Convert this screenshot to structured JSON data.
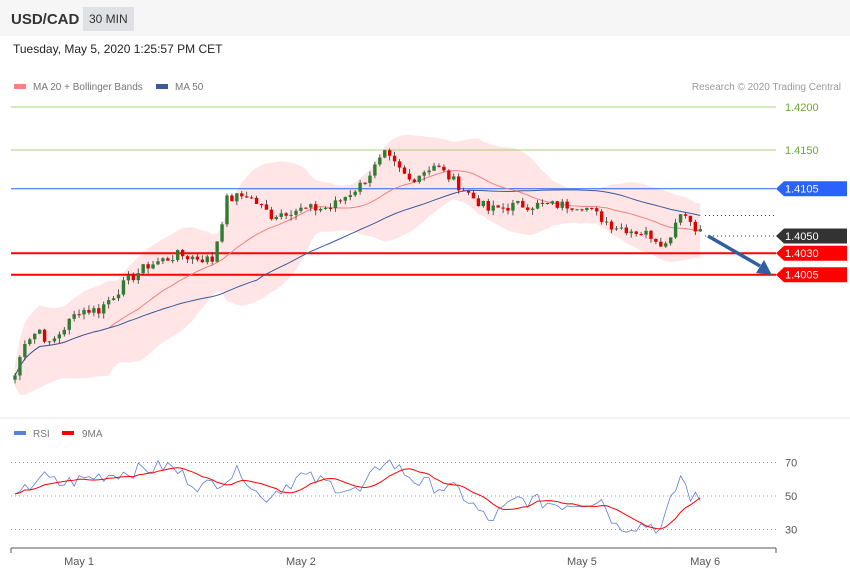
{
  "header": {
    "symbol": "USD/CAD",
    "timeframe": "30 MIN"
  },
  "timestamp": "Tuesday, May 5, 2020 1:25:57 PM CET",
  "legend": {
    "ma20": "MA 20 + Bollinger Bands",
    "ma50": "MA 50",
    "copyright": "Research © 2020 Trading Central"
  },
  "rsi_legend": {
    "rsi": "RSI",
    "ma9": "9MA"
  },
  "colors": {
    "up": "#2e7d32",
    "down": "#e00000",
    "ma20": "#f08080",
    "ma50": "#3a5a9a",
    "band": "#ffdede",
    "resistance": "#2962ff",
    "support": "#ff0000",
    "rsi": "#5b7fdc",
    "rsi_ma": "#ff0000",
    "target_grid": "#8bc34a"
  },
  "chart_data": {
    "type": "candlestick",
    "price_labels": [
      "1.4200",
      "1.4150"
    ],
    "levels": [
      {
        "value": "1.4105",
        "kind": "resistance"
      },
      {
        "value": "1.4050",
        "kind": "last"
      },
      {
        "value": "1.4030",
        "kind": "support"
      },
      {
        "value": "1.4005",
        "kind": "support"
      }
    ],
    "x_labels": [
      {
        "label": "May 1",
        "index": 13
      },
      {
        "label": "May 2",
        "index": 58
      },
      {
        "label": "May 5",
        "index": 115
      },
      {
        "label": "May 6",
        "index": 140
      }
    ],
    "close_keypoints": [
      [
        0,
        1.3888
      ],
      [
        2,
        1.3929
      ],
      [
        5,
        1.3941
      ],
      [
        7,
        1.3923
      ],
      [
        13,
        1.3964
      ],
      [
        17,
        1.3964
      ],
      [
        23,
        1.3999
      ],
      [
        27,
        1.4016
      ],
      [
        33,
        1.4028
      ],
      [
        40,
        1.4022
      ],
      [
        43,
        1.4092
      ],
      [
        47,
        1.4098
      ],
      [
        52,
        1.4074
      ],
      [
        56,
        1.408
      ],
      [
        64,
        1.4083
      ],
      [
        70,
        1.4109
      ],
      [
        75,
        1.4144
      ],
      [
        80,
        1.4115
      ],
      [
        85,
        1.4133
      ],
      [
        90,
        1.4109
      ],
      [
        96,
        1.408
      ],
      [
        102,
        1.4086
      ],
      [
        111,
        1.4086
      ],
      [
        115,
        1.4086
      ],
      [
        121,
        1.4063
      ],
      [
        129,
        1.4051
      ],
      [
        132,
        1.404
      ],
      [
        135,
        1.408
      ],
      [
        139,
        1.4055
      ]
    ],
    "candle_count": 140,
    "rsi": {
      "levels": [
        "70",
        "50",
        "30"
      ],
      "keypoints": [
        [
          0,
          47
        ],
        [
          5,
          62
        ],
        [
          9,
          57
        ],
        [
          17,
          62
        ],
        [
          31,
          68
        ],
        [
          38,
          55
        ],
        [
          46,
          65
        ],
        [
          50,
          48
        ],
        [
          58,
          62
        ],
        [
          70,
          52
        ],
        [
          75,
          72
        ],
        [
          82,
          58
        ],
        [
          90,
          53
        ],
        [
          96,
          35
        ],
        [
          102,
          48
        ],
        [
          111,
          45
        ],
        [
          119,
          48
        ],
        [
          122,
          32
        ],
        [
          129,
          33
        ],
        [
          131,
          30
        ],
        [
          135,
          62
        ],
        [
          137,
          50
        ],
        [
          139,
          47
        ]
      ]
    }
  }
}
